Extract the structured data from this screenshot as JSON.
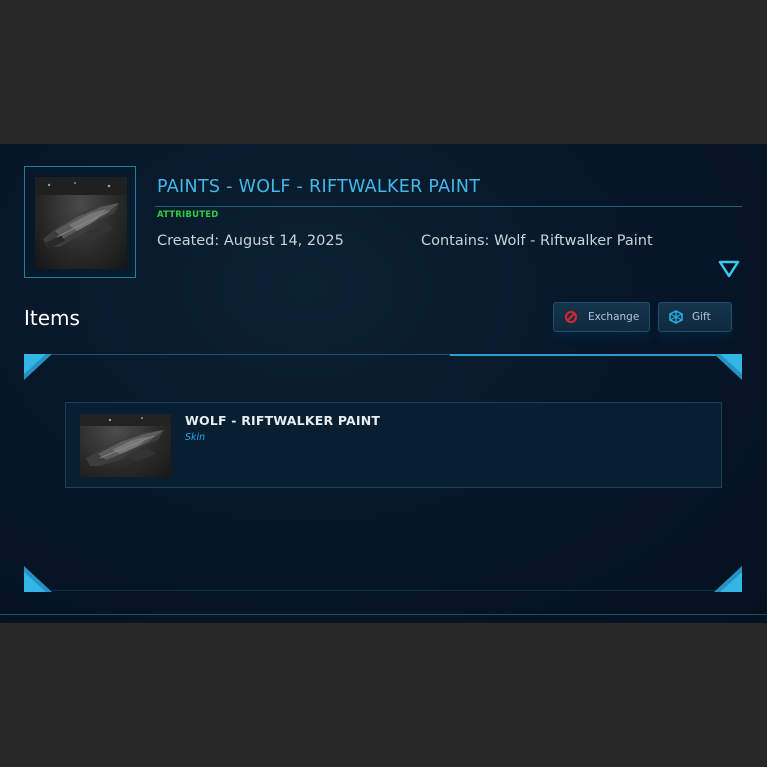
{
  "package": {
    "title": "PAINTS - WOLF - RIFTWALKER PAINT",
    "status": "ATTRIBUTED",
    "created": "Created: August 14, 2025",
    "contains": "Contains: Wolf - Riftwalker Paint",
    "thumbnail": "wolf-ship-image"
  },
  "items_section": {
    "heading": "Items",
    "actions": [
      {
        "label": "Exchange",
        "icon": "exchange-icon",
        "icon_color": "#e0222e"
      },
      {
        "label": "Gift",
        "icon": "gift-icon",
        "icon_color": "#2aa8e0"
      }
    ],
    "items": [
      {
        "name": "WOLF - RIFTWALKER PAINT",
        "type": "Skin",
        "thumbnail": "wolf-ship-image"
      }
    ]
  },
  "colors": {
    "title": "#42b8e8",
    "status": "#2ecc40",
    "accent": "#2a9ed0",
    "background": "#07172a",
    "page": "#262626"
  }
}
